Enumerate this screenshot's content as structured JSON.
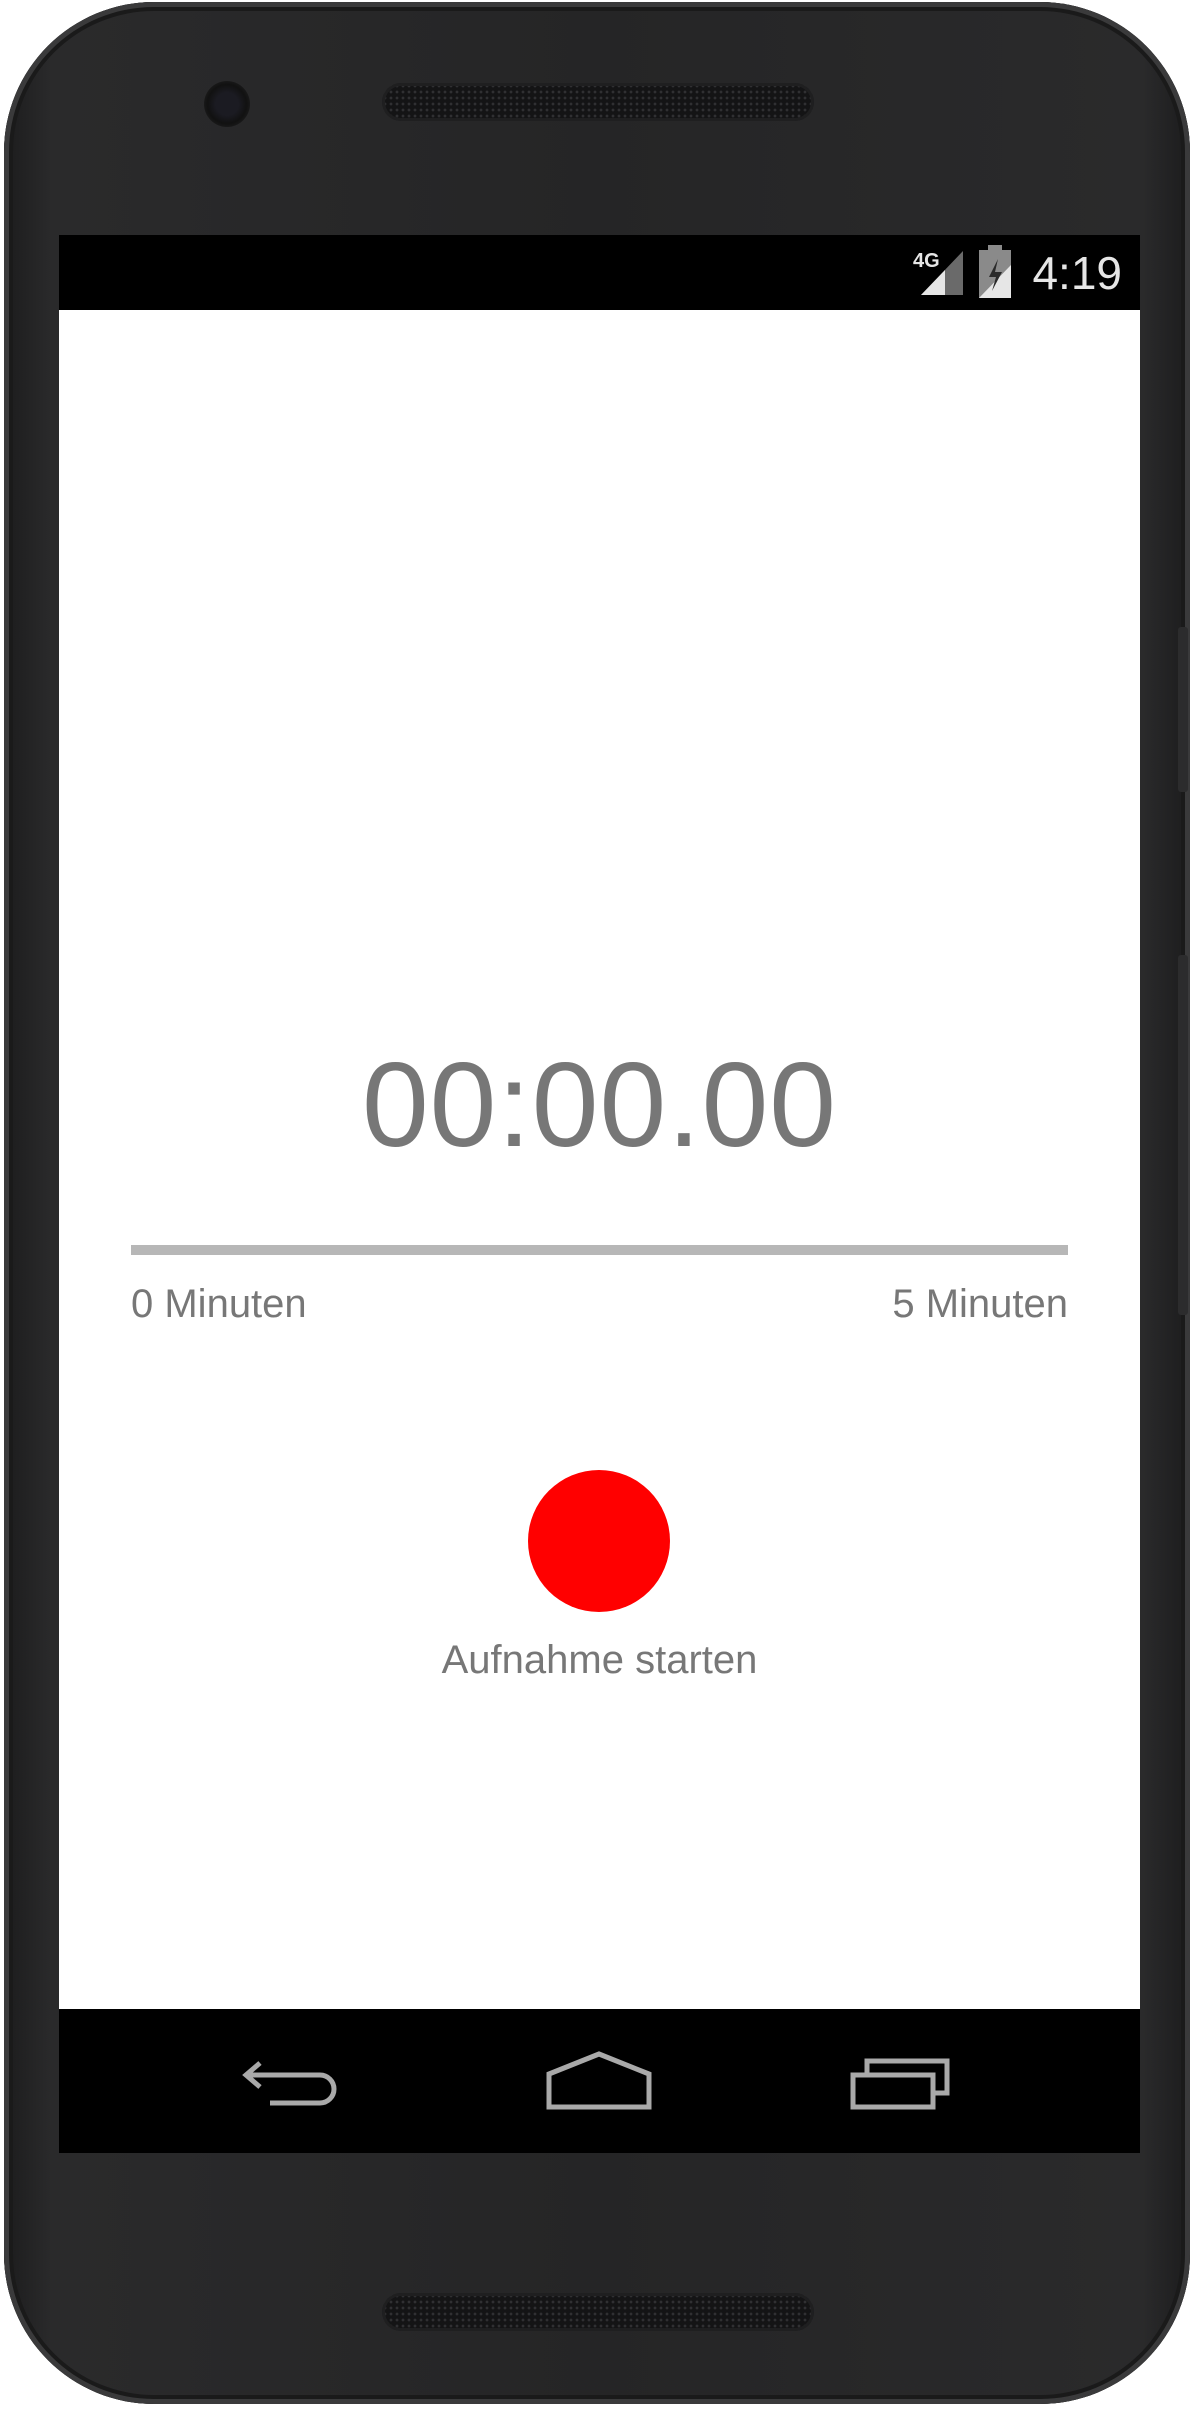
{
  "status_bar": {
    "network": "4G",
    "time": "4:19",
    "icons": [
      "signal-icon",
      "battery-icon"
    ]
  },
  "recorder": {
    "timer": "00:00.00",
    "progress": 0,
    "range_start_label": "0 Minuten",
    "range_end_label": "5 Minuten",
    "record_button_color": "#ff0000",
    "record_label": "Aufnahme starten"
  },
  "nav_bar": {
    "icons": [
      "back-icon",
      "home-icon",
      "recents-icon"
    ]
  },
  "colors": {
    "text_gray": "#777777",
    "track_gray": "#b7b7b7",
    "record_red": "#ff0000",
    "system_bar": "#000000",
    "device_body": "#252526"
  }
}
